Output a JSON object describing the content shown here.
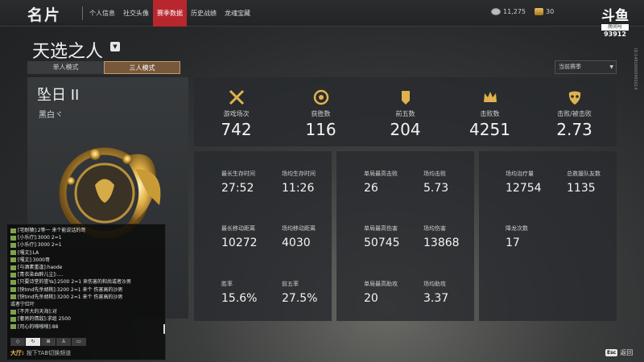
{
  "header": {
    "title": "名片",
    "tabs": [
      {
        "label": "个人信息",
        "active": false
      },
      {
        "label": "社交头像",
        "active": false
      },
      {
        "label": "赛季数据",
        "active": true
      },
      {
        "label": "历史战绩",
        "active": false
      },
      {
        "label": "龙魂宝藏",
        "active": false
      }
    ],
    "silver_amount": "11,275",
    "gold_amount": "30"
  },
  "watermark": {
    "logo": "斗鱼",
    "room_label": "房间号",
    "room_number": "93912",
    "side_id": "ID:14916000491614"
  },
  "mode": {
    "title": "天选之人",
    "tabs": [
      {
        "label": "单人模式",
        "active": false
      },
      {
        "label": "三人模式",
        "active": true
      }
    ],
    "season_select": "当前赛季"
  },
  "rank": {
    "name": "坠日 II",
    "subtitle": "黑白ヾ"
  },
  "summary": [
    {
      "label": "游戏场次",
      "value": "742",
      "icon": "crossed-swords-icon"
    },
    {
      "label": "获胜数",
      "value": "116",
      "icon": "laurel-emblem-icon"
    },
    {
      "label": "前五数",
      "value": "204",
      "icon": "banner-icon"
    },
    {
      "label": "击败数",
      "value": "4251",
      "icon": "crown-icon"
    },
    {
      "label": "击败/被击败",
      "value": "2.73",
      "icon": "mask-icon"
    }
  ],
  "stats_survival": [
    {
      "label": "最长生存时间",
      "value": "27:52"
    },
    {
      "label": "场均生存时间",
      "value": "11:26"
    },
    {
      "label": "最长移动距离",
      "value": "10272"
    },
    {
      "label": "场均移动距离",
      "value": "4030"
    },
    {
      "label": "胜率",
      "value": "15.6%"
    },
    {
      "label": "前五率",
      "value": "27.5%"
    }
  ],
  "stats_combat": [
    {
      "label": "单局最高击败",
      "value": "26"
    },
    {
      "label": "场均击败",
      "value": "5.73"
    },
    {
      "label": "单局最高伤害",
      "value": "50745"
    },
    {
      "label": "场均伤害",
      "value": "13868"
    },
    {
      "label": "单局最高助攻",
      "value": "20"
    },
    {
      "label": "场均助攻",
      "value": "3.37"
    }
  ],
  "stats_support": [
    {
      "label": "场均治疗量",
      "value": "12754"
    },
    {
      "label": "总救援队友数",
      "value": "1135"
    },
    {
      "label": "降龙次数",
      "value": "17"
    }
  ],
  "chat": {
    "messages": [
      "[宅耐猿]:2等一 来个能说话的哥",
      "[小乐疗]:3000  2=1",
      "[小乐疗]:3000 2=1",
      "[嘎文]:LA",
      "[嘎文]:3000哥",
      "[与酒素重逢]:haode",
      "[青衣染血醉儿尘]:....",
      "[只要诗堂的誉Ya]:2500 2=1 来伤害的和尚或者沙男",
      "[快tmd先杀胡桃]:3200 2=1 来个 伤害高的沙男",
      "[快tmd先杀胡桃]:3200 2=1 来个 伤害高的沙男",
      "或者宁红叶",
      "[不开大的天海]:对",
      "[奢男的情敌]:求组 2500",
      "[司心的啪啪啪]:88"
    ],
    "tools": [
      "◇",
      "↻",
      "⊞",
      "♙",
      "▭"
    ],
    "channel": "大厅:",
    "input_hint": "按下TAB切换频道"
  },
  "back": {
    "key": "Esc",
    "label": "返回"
  },
  "colors": {
    "accent_red": "#b8272d",
    "gold": "#e0b24c",
    "panel": "#2a2d30"
  }
}
